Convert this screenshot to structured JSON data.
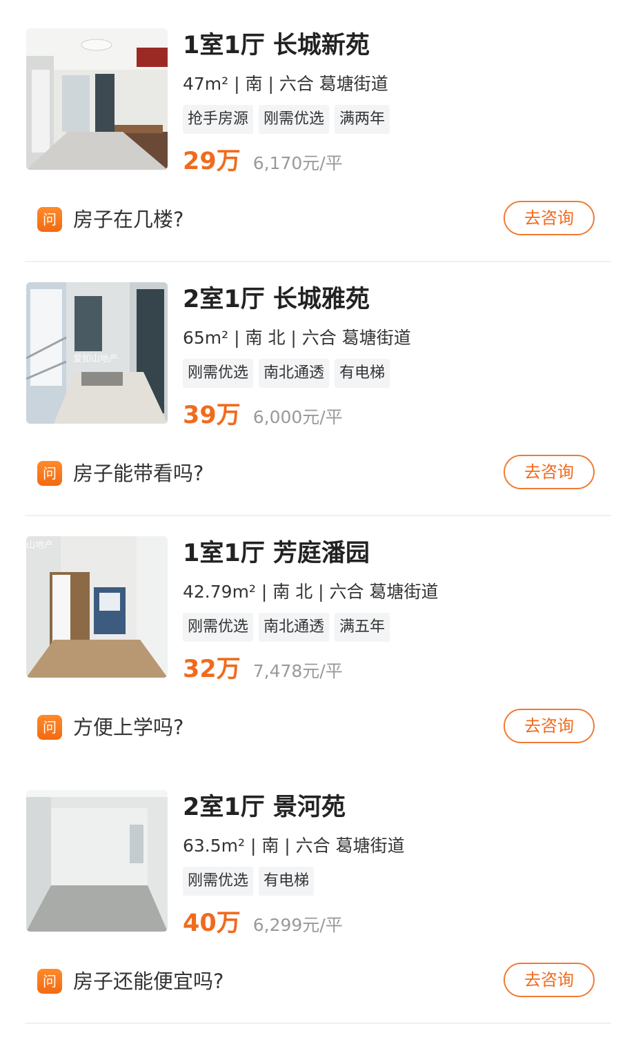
{
  "listings": [
    {
      "title": "1室1厅 长城新苑",
      "meta": "47m² | 南 | 六合 葛塘街道",
      "tags": [
        "抢手房源",
        "刚需优选",
        "满两年"
      ],
      "price": "29万",
      "unit_price": "6,170元/平",
      "question": "房子在几楼?",
      "ask_icon": "问",
      "consult_label": "去咨询"
    },
    {
      "title": "2室1厅 长城雅苑",
      "meta": "65m² | 南 北 | 六合 葛塘街道",
      "tags": [
        "刚需优选",
        "南北通透",
        "有电梯"
      ],
      "price": "39万",
      "unit_price": "6,000元/平",
      "question": "房子能带看吗?",
      "ask_icon": "问",
      "consult_label": "去咨询",
      "watermark": "爱如山地产"
    },
    {
      "title": "1室1厅 芳庭潘园",
      "meta": "42.79m² | 南 北 | 六合 葛塘街道",
      "tags": [
        "刚需优选",
        "南北通透",
        "满五年"
      ],
      "price": "32万",
      "unit_price": "7,478元/平",
      "question": "方便上学吗?",
      "ask_icon": "问",
      "consult_label": "去咨询",
      "watermark": "山地产"
    },
    {
      "title": "2室1厅 景河苑",
      "meta": "63.5m² | 南 | 六合 葛塘街道",
      "tags": [
        "刚需优选",
        "有电梯"
      ],
      "price": "40万",
      "unit_price": "6,299元/平",
      "question": "房子还能便宜吗?",
      "ask_icon": "问",
      "consult_label": "去咨询"
    }
  ],
  "colors": {
    "accent": "#f06b1e",
    "tag_bg": "#f3f4f6",
    "divider": "#f0f0f0"
  }
}
